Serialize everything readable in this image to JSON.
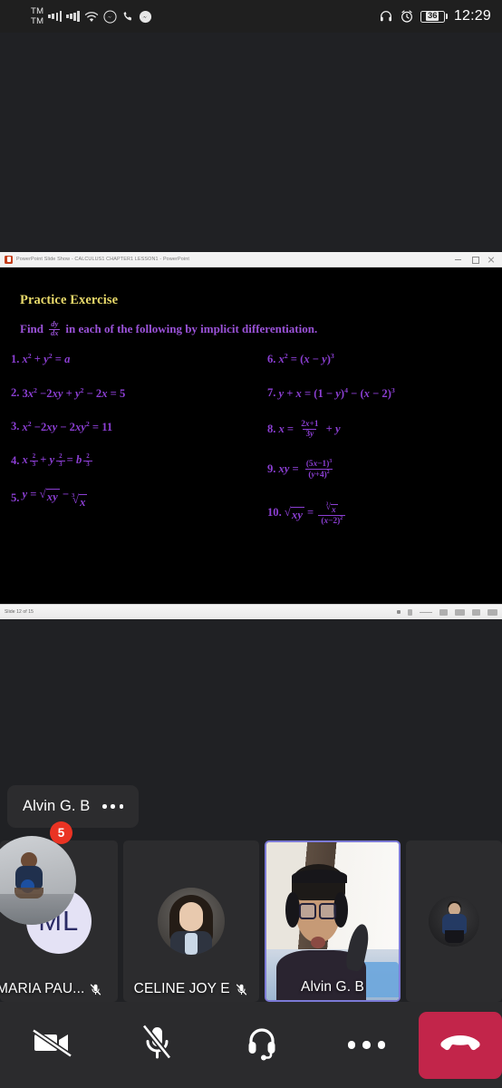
{
  "status_bar": {
    "carrier_1": "TM",
    "carrier_2": "TM",
    "icons": [
      "signal-bars-sim1-icon",
      "signal-bars-sim2-icon",
      "wifi-icon",
      "messenger-icon",
      "phone-call-icon",
      "messenger-icon-2"
    ],
    "right_icons": [
      "headphones-icon",
      "alarm-clock-icon"
    ],
    "battery_level": "36",
    "time": "12:29"
  },
  "shared_screen": {
    "app_window": {
      "title": "PowerPoint Slide Show  -  CALCULUS1 CHAPTER1 LESSON1  -  PowerPoint",
      "window_buttons": [
        "minimize",
        "maximize",
        "close"
      ],
      "status_bar_left": "Slide 12 of 15"
    },
    "slide": {
      "heading": "Practice Exercise",
      "heading_color": "#e8d96a",
      "body_color": "#8c3fd4",
      "intro_prefix": "Find",
      "intro_fraction_num": "dy",
      "intro_fraction_den": "dx",
      "intro_suffix": "in each of the following by implicit differentiation.",
      "left_column": [
        {
          "num": "1.",
          "eq": "x² + y² = a"
        },
        {
          "num": "2.",
          "eq": "3x² − 2xy + y² − 2x = 5"
        },
        {
          "num": "3.",
          "eq": "x² − 2xy − 2xy² = 11"
        },
        {
          "num": "4.",
          "eq": "x^(2/3) + y^(2/3) = b^(2/3)"
        },
        {
          "num": "5.",
          "eq": "y = √(xy) − ∛x"
        }
      ],
      "right_column": [
        {
          "num": "6.",
          "eq": "x² = (x − y)³"
        },
        {
          "num": "7.",
          "eq": "y + x = (1 − y)⁴ − (x − 2)³"
        },
        {
          "num": "8.",
          "eq": "x = (2x+1)/(3y) + y"
        },
        {
          "num": "9.",
          "eq": "xy = (5x−1)³/(y+4)²"
        },
        {
          "num": "10.",
          "eq": "√(xy) = ∛x/(x−2)²"
        }
      ]
    }
  },
  "self_view": {
    "name": "Alvin G. B",
    "more_label": "more-options",
    "notification_badge": "5"
  },
  "participants": [
    {
      "name": "MARIA PAU...",
      "avatar_type": "initials",
      "initials": "ML",
      "muted": true,
      "active_speaker": false
    },
    {
      "name": "CELINE JOY E",
      "avatar_type": "photo",
      "initials": "",
      "muted": true,
      "active_speaker": false
    },
    {
      "name": "Alvin G. B",
      "avatar_type": "video",
      "initials": "",
      "muted": false,
      "active_speaker": true
    },
    {
      "name": "",
      "avatar_type": "photo",
      "initials": "",
      "muted": false,
      "active_speaker": false
    }
  ],
  "call_controls": {
    "items": [
      {
        "name": "camera-off-button",
        "icon": "video-camera-off-icon"
      },
      {
        "name": "microphone-off-button",
        "icon": "microphone-off-icon"
      },
      {
        "name": "audio-output-button",
        "icon": "headset-icon"
      },
      {
        "name": "more-options-button",
        "icon": "ellipsis-icon"
      },
      {
        "name": "end-call-button",
        "icon": "phone-hangup-icon"
      }
    ],
    "end_call_color": "#c2254a"
  }
}
